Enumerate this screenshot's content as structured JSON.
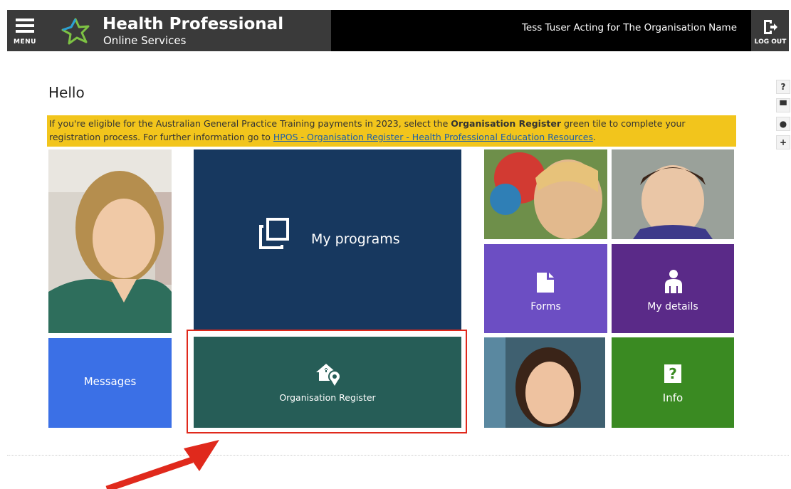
{
  "header": {
    "menu_label": "MENU",
    "title": "Health Professional",
    "subtitle": "Online Services",
    "user_text": "Tess Tuser Acting for The Organisation Name",
    "logout_label": "LOG OUT"
  },
  "main": {
    "greeting": "Hello",
    "notice": {
      "text_before": "If you're eligible for the Australian General Practice Training payments in 2023, select the ",
      "bold": "Organisation Register",
      "text_middle": " green tile to complete your registration process. For further information go to ",
      "link": "HPOS - Organisation Register - Health Professional Education Resources",
      "text_after": "."
    },
    "tiles": {
      "programs": "My programs",
      "org_register": "Organisation Register",
      "messages": "Messages",
      "forms": "Forms",
      "my_details": "My details",
      "info": "Info",
      "info_icon": "?"
    }
  },
  "side_tools": [
    "?",
    "▀",
    "●",
    "+"
  ],
  "colors": {
    "programs": "#17385f",
    "org_register": "#265d57",
    "messages": "#3b70e6",
    "forms": "#6c4ec3",
    "my_details": "#5a2a88",
    "info": "#3a8a22",
    "notice": "#f2c51c",
    "highlight": "#e0291c"
  }
}
